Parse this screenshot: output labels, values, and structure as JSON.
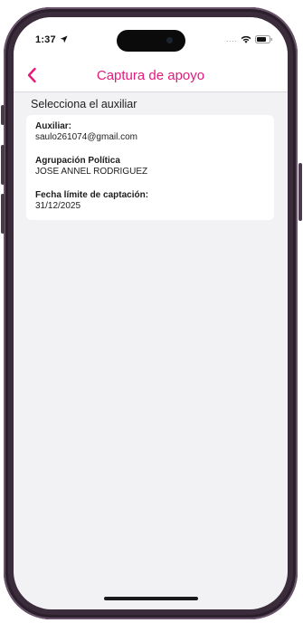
{
  "status_bar": {
    "time": "1:37",
    "location_icon": "location-arrow-icon",
    "signal_dots": "....",
    "wifi_icon": "wifi-icon",
    "battery_icon": "battery-icon"
  },
  "nav": {
    "back_icon": "chevron-left-icon",
    "title": "Captura de apoyo"
  },
  "main": {
    "section_title": "Selecciona el auxiliar",
    "card": {
      "fields": [
        {
          "label": "Auxiliar:",
          "value": "saulo261074@gmail.com"
        },
        {
          "label": "Agrupación Política",
          "value": "JOSE ANNEL RODRIGUEZ"
        },
        {
          "label": "Fecha límite de captación:",
          "value": "31/12/2025"
        }
      ]
    }
  },
  "colors": {
    "accent": "#e5197c",
    "background": "#f2f2f4",
    "frame": "#3a2c3b"
  }
}
